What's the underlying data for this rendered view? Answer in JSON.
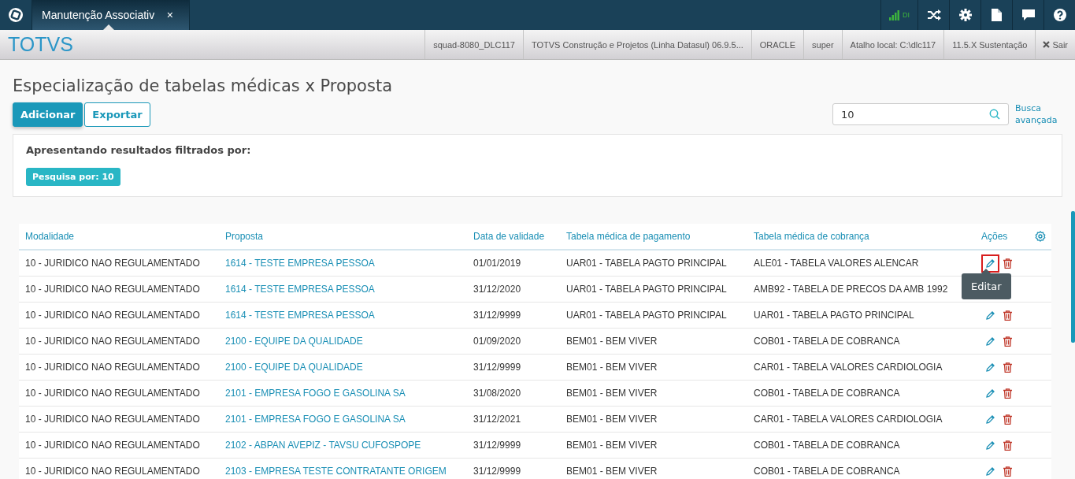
{
  "topbar": {
    "tab": {
      "label": "Manutenção Associativ",
      "close": "×",
      "selected": true
    },
    "status": "DI"
  },
  "infobar": {
    "brand": "TOTVS",
    "items": [
      "squad-8080_DLC117",
      "TOTVS Construção e Projetos (Linha Datasul) 06.9.5...",
      "ORACLE",
      "super",
      "Atalho local: C:\\dlc117",
      "11.5.X Sustentação"
    ],
    "logout": "Sair"
  },
  "page": {
    "title": "Especialização de tabelas médicas x Proposta",
    "buttons": [
      {
        "label": "Adicionar",
        "kind": "primary"
      },
      {
        "label": "Exportar",
        "kind": "secondary"
      }
    ],
    "search": {
      "value": "10"
    },
    "advanced_search": "Busca avançada"
  },
  "filter": {
    "caption": "Apresentando resultados filtrados por:",
    "tags": [
      "Pesquisa por: 10"
    ]
  },
  "table": {
    "columns": [
      "Modalidade",
      "Proposta",
      "Data de validade",
      "Tabela médica de pagamento",
      "Tabela médica de cobrança",
      "Ações"
    ],
    "rows": [
      {
        "cells": [
          "10 - JURIDICO NAO REGULAMENTADO",
          "1614 - TESTE EMPRESA PESSOA",
          "01/01/2019",
          "UAR01 - TABELA PAGTO PRINCIPAL",
          "ALE01 - TABELA VALORES ALENCAR"
        ],
        "focused": true,
        "actions": true
      },
      {
        "cells": [
          "10 - JURIDICO NAO REGULAMENTADO",
          "1614 - TESTE EMPRESA PESSOA",
          "31/12/2020",
          "UAR01 - TABELA PAGTO PRINCIPAL",
          "AMB92 - TABELA DE PRECOS DA AMB 1992"
        ],
        "actions": false
      },
      {
        "cells": [
          "10 - JURIDICO NAO REGULAMENTADO",
          "1614 - TESTE EMPRESA PESSOA",
          "31/12/9999",
          "UAR01 - TABELA PAGTO PRINCIPAL",
          "UAR01 - TABELA PAGTO PRINCIPAL"
        ],
        "focused": false,
        "actions": true
      },
      {
        "cells": [
          "10 - JURIDICO NAO REGULAMENTADO",
          "2100 - EQUIPE DA QUALIDADE",
          "01/09/2020",
          "BEM01 - BEM VIVER",
          "COB01 - TABELA DE COBRANCA"
        ],
        "focused": false,
        "actions": true
      },
      {
        "cells": [
          "10 - JURIDICO NAO REGULAMENTADO",
          "2100 - EQUIPE DA QUALIDADE",
          "31/12/9999",
          "BEM01 - BEM VIVER",
          "CAR01 - TABELA VALORES CARDIOLOGIA"
        ],
        "focused": false,
        "actions": true
      },
      {
        "cells": [
          "10 - JURIDICO NAO REGULAMENTADO",
          "2101 - EMPRESA FOGO E GASOLINA SA",
          "31/08/2020",
          "BEM01 - BEM VIVER",
          "COB01 - TABELA DE COBRANCA"
        ],
        "focused": false,
        "actions": true
      },
      {
        "cells": [
          "10 - JURIDICO NAO REGULAMENTADO",
          "2101 - EMPRESA FOGO E GASOLINA SA",
          "31/12/2021",
          "BEM01 - BEM VIVER",
          "CAR01 - TABELA VALORES CARDIOLOGIA"
        ],
        "focused": false,
        "actions": true
      },
      {
        "cells": [
          "10 - JURIDICO NAO REGULAMENTADO",
          "2102 - ABPAN AVEPIZ - TAVSU CUFOSPOPE",
          "31/12/9999",
          "BEM01 - BEM VIVER",
          "COB01 - TABELA DE COBRANCA"
        ],
        "focused": false,
        "actions": true
      },
      {
        "cells": [
          "10 - JURIDICO NAO REGULAMENTADO",
          "2103 - EMPRESA TESTE CONTRATANTE ORIGEM",
          "31/12/9999",
          "BEM01 - BEM VIVER",
          "COB01 - TABELA DE COBRANCA"
        ],
        "focused": false,
        "actions": true
      }
    ],
    "tooltip": "Editar"
  }
}
